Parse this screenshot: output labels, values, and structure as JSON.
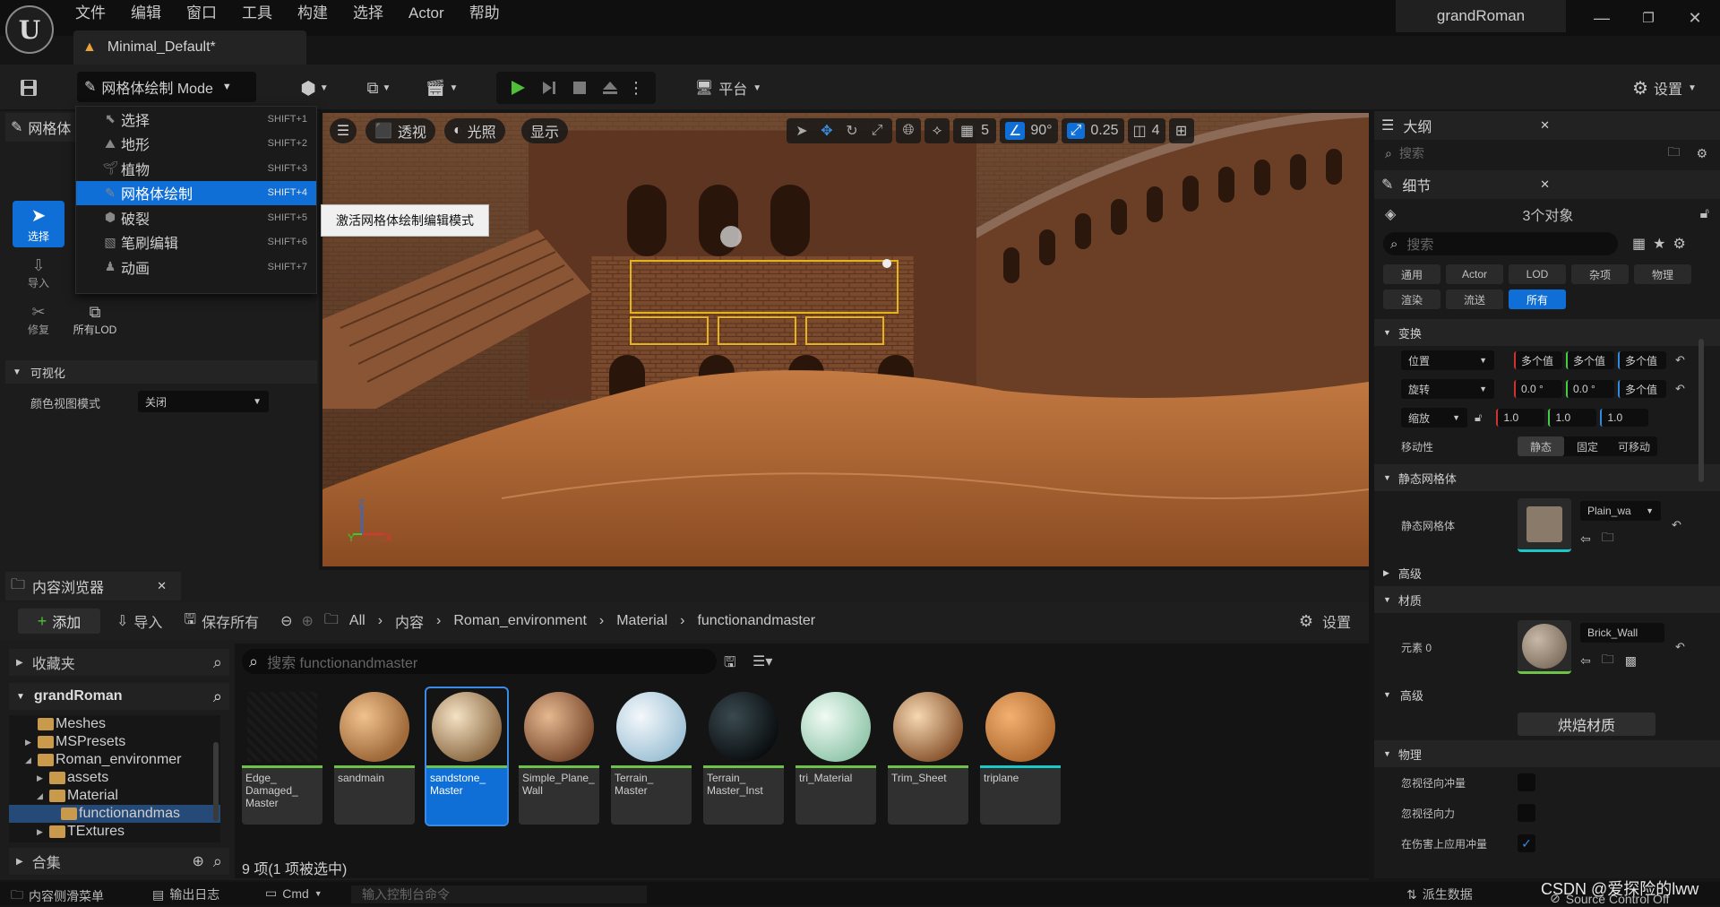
{
  "window": {
    "menu": [
      "文件",
      "编辑",
      "窗口",
      "工具",
      "构建",
      "选择",
      "Actor",
      "帮助"
    ],
    "project_name": "grandRoman",
    "doc_tab": "Minimal_Default*"
  },
  "toolbar": {
    "mode_label": "网格体绘制 Mode",
    "platform_label": "平台",
    "settings_label": "设置"
  },
  "left_panel": {
    "tab_label": "网格体",
    "tools": [
      {
        "label": "选择",
        "icon": "cursor-icon"
      },
      {
        "label": "导入",
        "icon": "import-icon"
      },
      {
        "label": "修复",
        "icon": "wrench-icon"
      },
      {
        "label": "所有LOD",
        "icon": "lod-icon"
      }
    ],
    "visualize_section": "可视化",
    "color_view_label": "颜色视图模式",
    "color_view_value": "关闭"
  },
  "mode_dropdown": {
    "items": [
      {
        "label": "选择",
        "shortcut": "SHIFT+1",
        "icon": "select-icon"
      },
      {
        "label": "地形",
        "shortcut": "SHIFT+2",
        "icon": "landscape-icon"
      },
      {
        "label": "植物",
        "shortcut": "SHIFT+3",
        "icon": "foliage-icon"
      },
      {
        "label": "网格体绘制",
        "shortcut": "SHIFT+4",
        "icon": "mesh-paint-icon"
      },
      {
        "label": "破裂",
        "shortcut": "SHIFT+5",
        "icon": "fracture-icon"
      },
      {
        "label": "笔刷编辑",
        "shortcut": "SHIFT+6",
        "icon": "brush-edit-icon"
      },
      {
        "label": "动画",
        "shortcut": "SHIFT+7",
        "icon": "animation-icon"
      }
    ],
    "selected_index": 3,
    "tooltip": "激活网格体绘制编辑模式"
  },
  "viewport": {
    "perspective": "透视",
    "lit": "光照",
    "show": "显示",
    "grid_snap": "5",
    "rot_snap": "90°",
    "scale_snap": "0.25",
    "camera_speed": "4"
  },
  "outliner": {
    "title": "大纲",
    "search_placeholder": "搜索"
  },
  "details": {
    "title": "细节",
    "object_count": "3个对象",
    "search_placeholder": "搜索",
    "filter_tabs_row1": [
      "通用",
      "Actor",
      "LOD",
      "杂项",
      "物理"
    ],
    "filter_tabs_row2": [
      "渲染",
      "流送",
      "所有"
    ],
    "active_tab": "所有",
    "transform_section": "变换",
    "location_label": "位置",
    "location_values": [
      "多个值",
      "多个值",
      "多个值"
    ],
    "rotation_label": "旋转",
    "rotation_values": [
      "0.0 °",
      "0.0 °",
      "多个值"
    ],
    "scale_label": "缩放",
    "scale_values": [
      "1.0",
      "1.0",
      "1.0"
    ],
    "mobility_label": "移动性",
    "mobility_options": [
      "静态",
      "固定",
      "可移动"
    ],
    "static_mesh_section": "静态网格体",
    "static_mesh_label": "静态网格体",
    "static_mesh_value": "Plain_wa",
    "advanced_label": "高级",
    "materials_section": "材质",
    "element0_label": "元素 0",
    "element0_value": "Brick_Wall",
    "advanced2_label": "高级",
    "bake_button": "烘焙材质",
    "physics_section": "物理",
    "physics_rows": [
      {
        "label": "忽视径向冲量",
        "checked": false
      },
      {
        "label": "忽视径向力",
        "checked": false
      },
      {
        "label": "在伤害上应用冲量",
        "checked": true
      }
    ]
  },
  "content_browser": {
    "tab_label": "内容浏览器",
    "add_button": "添加",
    "import_button": "导入",
    "save_all_button": "保存所有",
    "breadcrumb": [
      "All",
      "内容",
      "Roman_environment",
      "Material",
      "functionandmaster"
    ],
    "settings_label": "设置",
    "search_placeholder": "搜索 functionandmaster",
    "favorites_label": "收藏夹",
    "root_label": "grandRoman",
    "tree": [
      {
        "label": "Meshes",
        "indent": 2,
        "arrow": "",
        "selected": false
      },
      {
        "label": "MSPresets",
        "indent": 2,
        "arrow": "▶",
        "selected": false
      },
      {
        "label": "Roman_environmer",
        "indent": 2,
        "arrow": "◢",
        "selected": false
      },
      {
        "label": "assets",
        "indent": 3,
        "arrow": "▶",
        "selected": false
      },
      {
        "label": "Material",
        "indent": 3,
        "arrow": "◢",
        "selected": false
      },
      {
        "label": "functionandmas",
        "indent": 4,
        "arrow": "",
        "selected": true
      },
      {
        "label": "TExtures",
        "indent": 3,
        "arrow": "▶",
        "selected": false
      }
    ],
    "collections_label": "合集",
    "assets": [
      {
        "name": "Edge_ Damaged_ Master",
        "style": "dark"
      },
      {
        "name": "sandmain",
        "style": "sand"
      },
      {
        "name": "sandstone_ Master",
        "style": "sandstone"
      },
      {
        "name": "Simple_Plane_ Wall",
        "style": "stone"
      },
      {
        "name": "Terrain_ Master",
        "style": "sky"
      },
      {
        "name": "Terrain_ Master_Inst",
        "style": "darksky"
      },
      {
        "name": "tri_Material",
        "style": "mint"
      },
      {
        "name": "Trim_Sheet",
        "style": "trim"
      },
      {
        "name": "triplane",
        "style": "orange"
      }
    ],
    "selected_asset_index": 2,
    "status": "9 项(1 项被选中)"
  },
  "statusbar": {
    "drawer": "内容侧滑菜单",
    "output_log": "输出日志",
    "cmd": "Cmd",
    "console_placeholder": "输入控制台命令",
    "derived_data": "派生数据",
    "source_control": "Source Control Off"
  },
  "watermark": "CSDN @爱探险的lww",
  "colors": {
    "accent": "#0f6fd6",
    "play": "#4fbf3a",
    "panel": "#1c1c1c"
  }
}
